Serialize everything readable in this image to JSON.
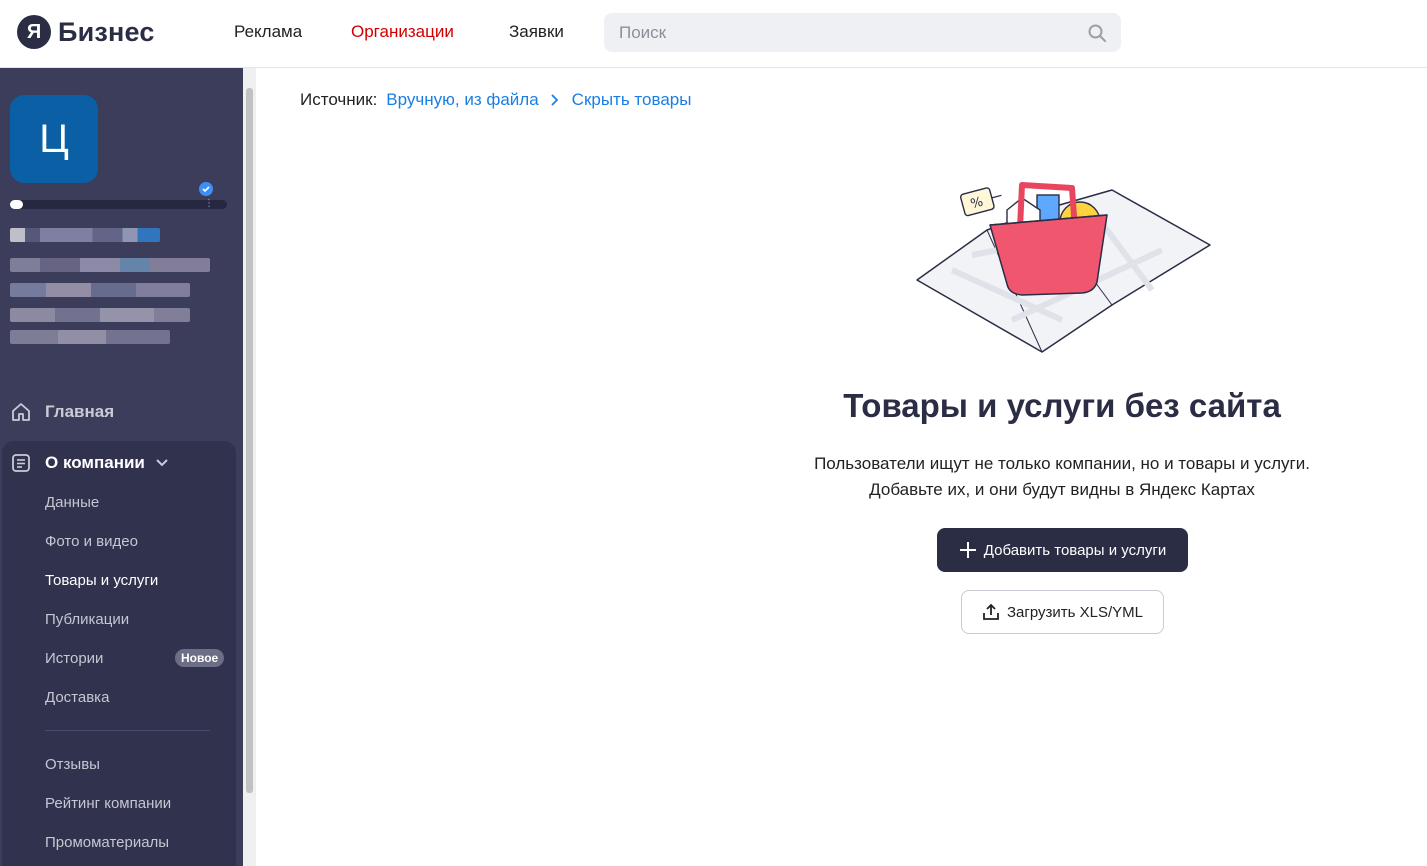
{
  "header": {
    "logo_letter": "Я",
    "logo_text": "Бизнес",
    "nav": {
      "ads": "Реклама",
      "orgs": "Организации",
      "requests": "Заявки"
    },
    "search_placeholder": "Поиск",
    "active_color": "#d10000"
  },
  "sidebar": {
    "avatar_letter": "Ц",
    "profile_progress": 0.06,
    "main_item": "Главная",
    "group_title": "О компании",
    "sub_items": [
      "Данные",
      "Фото и видео",
      "Товары и услуги",
      "Публикации",
      "Истории",
      "Доставка"
    ],
    "new_badge": "Новое",
    "bottom_items": [
      "Отзывы",
      "Рейтинг компании",
      "Промоматериалы"
    ],
    "background": "#3b3d5b"
  },
  "breadcrumb": {
    "label": "Источник:",
    "source_link": "Вручную, из файла",
    "hide_link": "Скрыть товары",
    "link_color": "#1a7ee6"
  },
  "main": {
    "title": "Товары и услуги без сайта",
    "desc_line1": "Пользователи ищут не только компании, но и товары и услуги.",
    "desc_line2": "Добавьте их, и они будут видны в Яндекс Картах",
    "add_button": "Добавить товары и услуги",
    "upload_button": "Загрузить XLS/YML",
    "illustration_tag": "%"
  }
}
